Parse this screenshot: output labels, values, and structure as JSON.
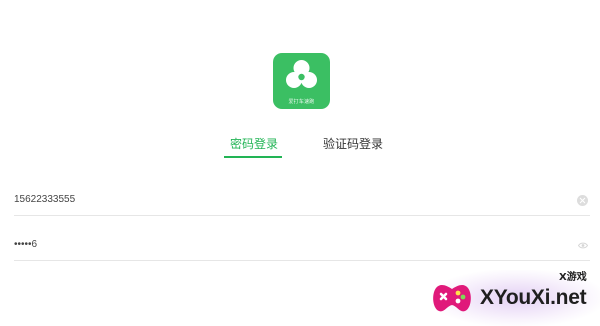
{
  "logo": {
    "icon": "three-circles-logo-icon",
    "caption": "爱打车速跑",
    "color": "#3bbf63"
  },
  "tabs": [
    {
      "label": "密码登录",
      "active": true
    },
    {
      "label": "验证码登录",
      "active": false
    }
  ],
  "form": {
    "phone": {
      "value": "15622333555",
      "clear_icon": "clear-icon"
    },
    "password": {
      "value": "•••••6",
      "toggle_icon": "eye-icon"
    }
  },
  "watermark": {
    "brand_cn": "X游戏",
    "brand_en": "XYouXi.net",
    "icon": "gamepad-icon"
  },
  "colors": {
    "accent": "#22b455",
    "divider": "#e6e6e6"
  }
}
